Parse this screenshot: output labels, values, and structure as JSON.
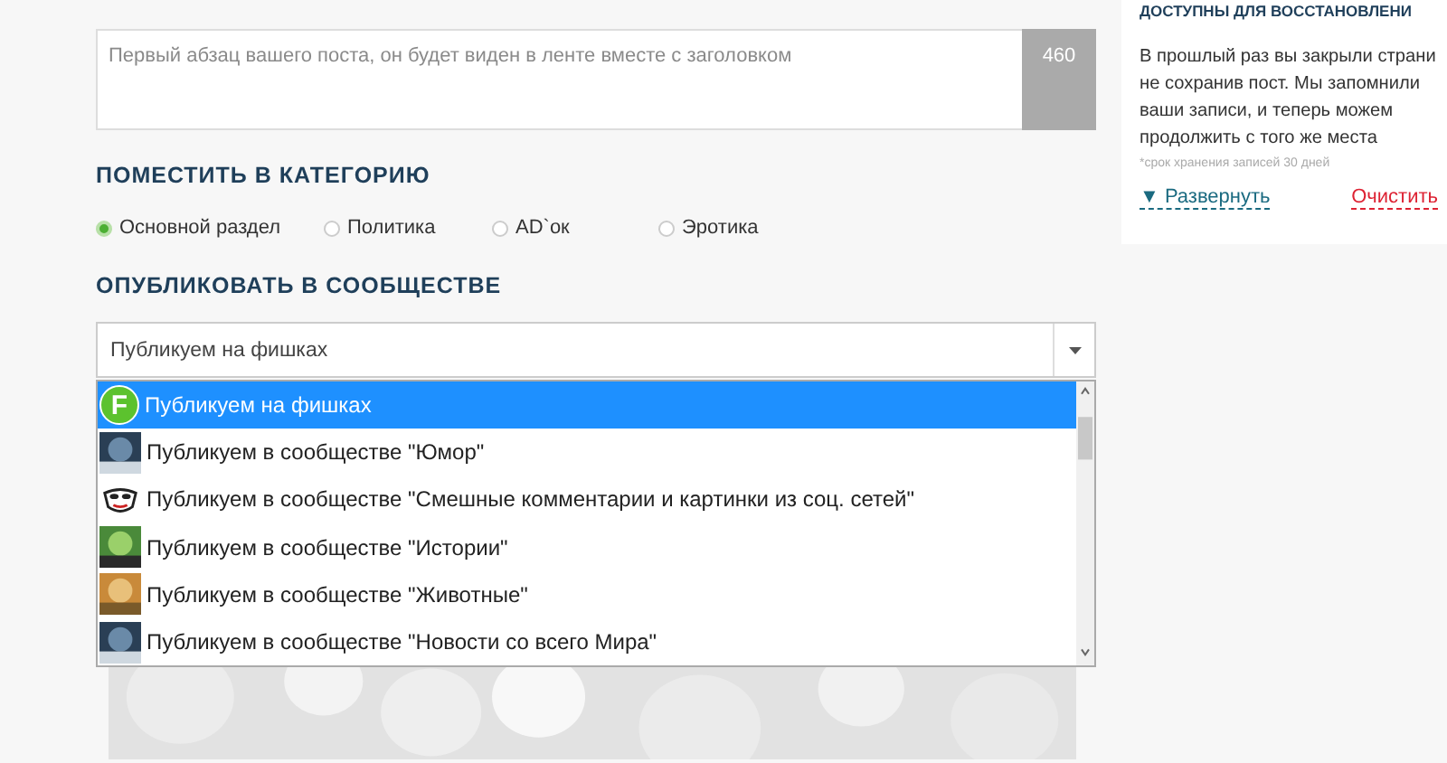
{
  "description_field": {
    "placeholder": "Первый абзац вашего поста, он будет виден в ленте вместе с заголовком",
    "counter": "460"
  },
  "category": {
    "heading": "ПОМЕСТИТЬ В КАТЕГОРИЮ",
    "options": [
      {
        "label": "Основной раздел",
        "selected": true
      },
      {
        "label": "Политика",
        "selected": false
      },
      {
        "label": "AD`ок",
        "selected": false
      },
      {
        "label": "Эротика",
        "selected": false
      }
    ]
  },
  "community": {
    "heading": "ОПУБЛИКОВАТЬ В СООБЩЕСТВЕ",
    "value": "Публикуем на фишках",
    "options": [
      {
        "label": "Публикуем на фишках",
        "selected": true,
        "kind": "logo",
        "logo_text": "F"
      },
      {
        "label": "Публикуем в сообществе \"Юмор\"",
        "selected": false,
        "kind": "picture"
      },
      {
        "label": "Публикуем в сообществе \"Смешные комментарии и картинки из соц. сетей\"",
        "selected": false,
        "kind": "mask"
      },
      {
        "label": "Публикуем в сообществе \"Истории\"",
        "selected": false,
        "kind": "picture"
      },
      {
        "label": "Публикуем в сообществе \"Животные\"",
        "selected": false,
        "kind": "picture"
      },
      {
        "label": "Публикуем в сообществе \"Новости со всего Мира\"",
        "selected": false,
        "kind": "picture"
      }
    ]
  },
  "restore_panel": {
    "heading": "ДОСТУПНЫ ДЛЯ ВОССТАНОВЛЕНИ",
    "text_lines": [
      "В прошлый раз вы закрыли страни",
      "не сохранив пост. Мы запомнили",
      "ваши записи, и теперь можем",
      "продолжить с того же места"
    ],
    "note": "*срок хранения записей 30 дней",
    "expand_link": "▼ Развернуть",
    "clear_link": "Очистить"
  }
}
